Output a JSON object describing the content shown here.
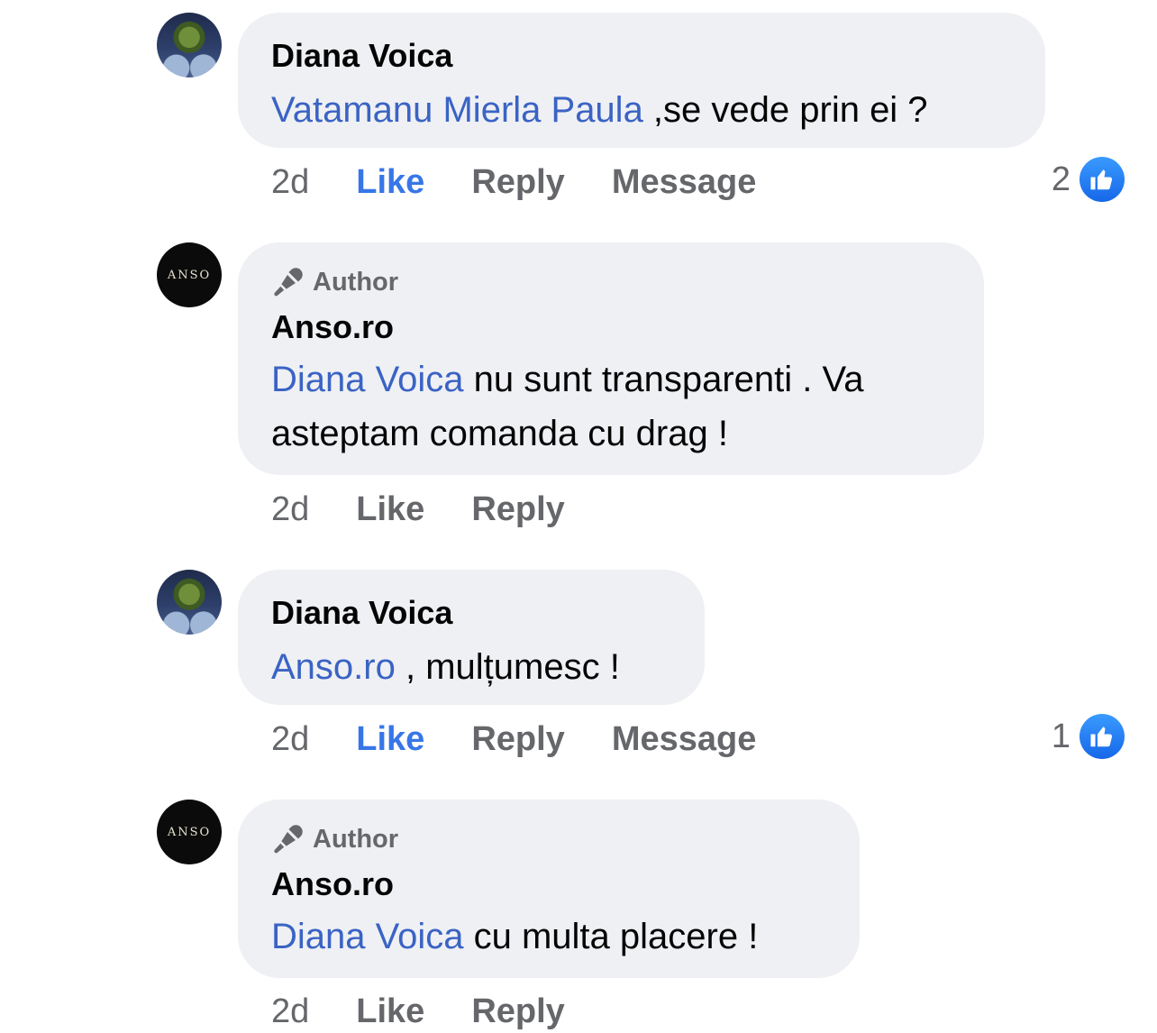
{
  "comments": [
    {
      "author": "Diana Voica",
      "mention": "Vatamanu Mierla Paula",
      "text": " ,se vede prin ei ?",
      "time": "2d",
      "like_label": "Like",
      "reply_label": "Reply",
      "message_label": "Message",
      "reaction_count": "2",
      "liked": true
    },
    {
      "badge": "Author",
      "author": "Anso.ro",
      "avatar_text": "ANSO",
      "mention": "Diana Voica",
      "text": " nu sunt transparenti . Va asteptam comanda cu drag !",
      "time": "2d",
      "like_label": "Like",
      "reply_label": "Reply"
    },
    {
      "author": "Diana Voica",
      "mention": "Anso.ro",
      "text": " , mulțumesc !",
      "time": "2d",
      "like_label": "Like",
      "reply_label": "Reply",
      "message_label": "Message",
      "reaction_count": "1",
      "liked": true
    },
    {
      "badge": "Author",
      "author": "Anso.ro",
      "avatar_text": "ANSO",
      "mention": "Diana Voica",
      "text": " cu multa placere !",
      "time": "2d",
      "like_label": "Like",
      "reply_label": "Reply"
    }
  ],
  "colors": {
    "mention": "#3a63c4",
    "liked": "#3876e8",
    "bubble": "#eff0f4",
    "muted": "#65676b"
  },
  "icons": {
    "author_badge": "microphone-icon",
    "reaction": "thumbs-up-icon"
  }
}
